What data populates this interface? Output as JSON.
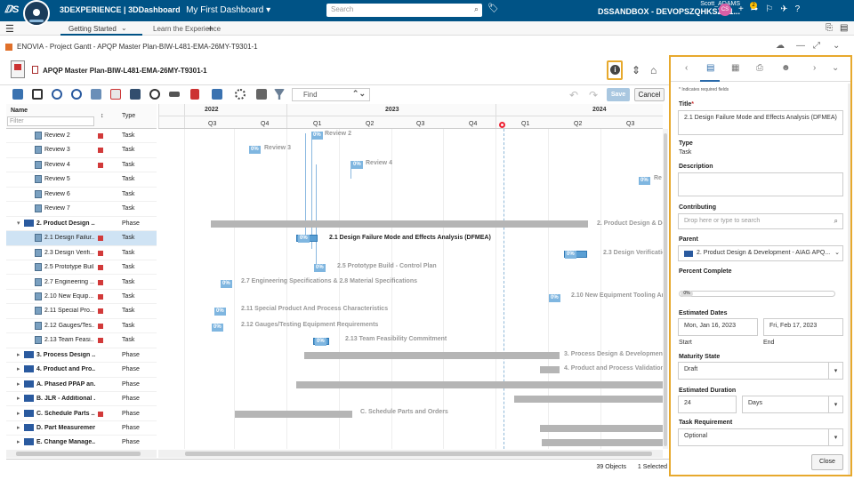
{
  "topbar": {
    "brand_pre": "3DEXPERIENCE",
    "brand_sep": " | ",
    "brand_app": "3DDashboard",
    "dashboard": "My First Dashboard",
    "search_placeholder": "Search",
    "user_name": "Scott_ADAMS",
    "platform": "DSSANDBOX - DEVOPSZQHKSZM1...",
    "avatar_initials": "CS",
    "notif_count": "2"
  },
  "tabs": {
    "active": "Getting Started",
    "second": "Learn the Experience"
  },
  "widget": {
    "title": "ENOVIA - Project Gantt - APQP Master Plan-BIW-L481-EMA-26MY-T9301-1",
    "object_title": "APQP Master Plan-BIW-L481-EMA-26MY-T9301-1"
  },
  "toolbar": {
    "find_placeholder": "Find",
    "save_label": "Save",
    "cancel_label": "Cancel"
  },
  "grid": {
    "col_name": "Name",
    "col_type": "Type",
    "filter_placeholder": "Filter",
    "rows": [
      {
        "name": "Review 2",
        "type": "Task",
        "flag": true,
        "level": 2
      },
      {
        "name": "Review 3",
        "type": "Task",
        "flag": true,
        "level": 2
      },
      {
        "name": "Review 4",
        "type": "Task",
        "flag": true,
        "level": 2
      },
      {
        "name": "Review 5",
        "type": "Task",
        "flag": false,
        "level": 2
      },
      {
        "name": "Review 6",
        "type": "Task",
        "flag": false,
        "level": 2
      },
      {
        "name": "Review 7",
        "type": "Task",
        "flag": false,
        "level": 2
      },
      {
        "name": "2. Product Design ...",
        "type": "Phase",
        "flag": false,
        "level": 1,
        "expanded": true
      },
      {
        "name": "2.1 Design Failur...",
        "type": "Task",
        "flag": true,
        "level": 2,
        "selected": true
      },
      {
        "name": "2.3 Design Verifi...",
        "type": "Task",
        "flag": true,
        "level": 2
      },
      {
        "name": "2.5 Prototype Buil...",
        "type": "Task",
        "flag": true,
        "level": 2
      },
      {
        "name": "2.7 Engineering ...",
        "type": "Task",
        "flag": true,
        "level": 2
      },
      {
        "name": "2.10 New Equip...",
        "type": "Task",
        "flag": true,
        "level": 2
      },
      {
        "name": "2.11 Special Pro...",
        "type": "Task",
        "flag": true,
        "level": 2
      },
      {
        "name": "2.12 Gauges/Tes...",
        "type": "Task",
        "flag": true,
        "level": 2
      },
      {
        "name": "2.13 Team Feasi...",
        "type": "Task",
        "flag": true,
        "level": 2
      },
      {
        "name": "3. Process Design ...",
        "type": "Phase",
        "flag": false,
        "level": 1
      },
      {
        "name": "4. Product and Pro...",
        "type": "Phase",
        "flag": false,
        "level": 1
      },
      {
        "name": "A. Phased PPAP an...",
        "type": "Phase",
        "flag": false,
        "level": 1
      },
      {
        "name": "B. JLR - Additional ...",
        "type": "Phase",
        "flag": false,
        "level": 1
      },
      {
        "name": "C. Schedule Parts ...",
        "type": "Phase",
        "flag": true,
        "level": 1
      },
      {
        "name": "D. Part Measurement",
        "type": "Phase",
        "flag": false,
        "level": 1
      },
      {
        "name": "E. Change Manage...",
        "type": "Phase",
        "flag": false,
        "level": 1
      }
    ]
  },
  "gantt": {
    "years": [
      "2022",
      "2023",
      "2024"
    ],
    "quarters": [
      "Q3",
      "Q4",
      "Q1",
      "Q2",
      "Q3",
      "Q4",
      "Q1",
      "Q2",
      "Q3"
    ],
    "labels": {
      "review2": "Review 2",
      "review3": "Review 3",
      "review4": "Review 4",
      "review5": "Re",
      "phase2": "2. Product Design & De",
      "t21": "2.1 Design Failure Mode and Effects Analysis (DFMEA)",
      "t23": "2.3 Design Verificatio",
      "t25": "2.5 Prototype Build - Control Plan",
      "t27": "2.7 Engineering Specifications & 2.8 Material Specifications",
      "t210": "2.10 New Equipment Tooling And",
      "t211": "2.11 Special Product And Process Characteristics",
      "t212": "2.12 Gauges/Testing Equipment Requirements",
      "t213": "2.13 Team Feasibility Commitment",
      "phase3": "3. Process Design & Development -",
      "phase4": "4. Product and Process Validation -",
      "phaseC": "C. Schedule Parts and Orders"
    },
    "pct": "0%"
  },
  "status": {
    "objects": "39 Objects",
    "selected": "1 Selected"
  },
  "panel": {
    "required_note": "* Indicates required fields",
    "title_label": "Title",
    "title_value": "2.1 Design Failure Mode and Effects Analysis (DFMEA)",
    "type_label": "Type",
    "type_value": "Task",
    "description_label": "Description",
    "contributing_label": "Contributing",
    "contributing_placeholder": "Drop here or type to search",
    "parent_label": "Parent",
    "parent_value": "2. Product Design & Development - AIAG APQ...",
    "percent_label": "Percent Complete",
    "percent_value": "0%",
    "percent_complete": 0,
    "dates_label": "Estimated Dates",
    "start_value": "Mon, Jan 16, 2023",
    "end_value": "Fri, Feb 17, 2023",
    "start_label": "Start",
    "end_label": "End",
    "maturity_label": "Maturity State",
    "maturity_value": "Draft",
    "duration_label": "Estimated Duration",
    "duration_value": "24",
    "duration_unit": "Days",
    "requirement_label": "Task Requirement",
    "requirement_value": "Optional",
    "close_label": "Close"
  },
  "colors": {
    "topbar": "#005386",
    "highlight": "#e7a92d",
    "flag": "#d23a3a",
    "task_bar": "#5a9fd4",
    "phase_bar": "#b5b5b5"
  }
}
